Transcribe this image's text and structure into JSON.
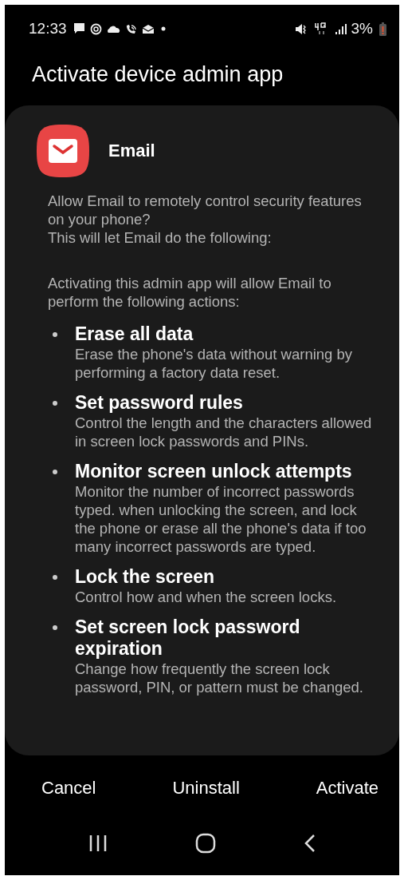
{
  "status_bar": {
    "time": "12:33",
    "battery": "3%"
  },
  "title": "Activate device admin app",
  "app": {
    "name": "Email"
  },
  "intro": [
    "Allow Email to remotely control security features on your phone?",
    "This will let Email do the following:"
  ],
  "lead": "Activating this admin app will allow Email to perform the following actions:",
  "permissions": [
    {
      "title": "Erase all data",
      "description": "Erase the phone's data without warning by performing a factory data reset."
    },
    {
      "title": "Set password rules",
      "description": "Control the length and the characters allowed in screen lock passwords and PINs."
    },
    {
      "title": "Monitor screen unlock attempts",
      "description": "Monitor the number of incorrect passwords typed. when unlocking the screen, and lock the phone or erase all the phone's data if too many incorrect passwords are typed."
    },
    {
      "title": "Lock the screen",
      "description": "Control how and when the screen locks."
    },
    {
      "title": "Set screen lock password expiration",
      "description": "Change how frequently the screen lock password, PIN, or pattern must be changed."
    }
  ],
  "buttons": [
    "Cancel",
    "Uninstall",
    "Activate"
  ]
}
